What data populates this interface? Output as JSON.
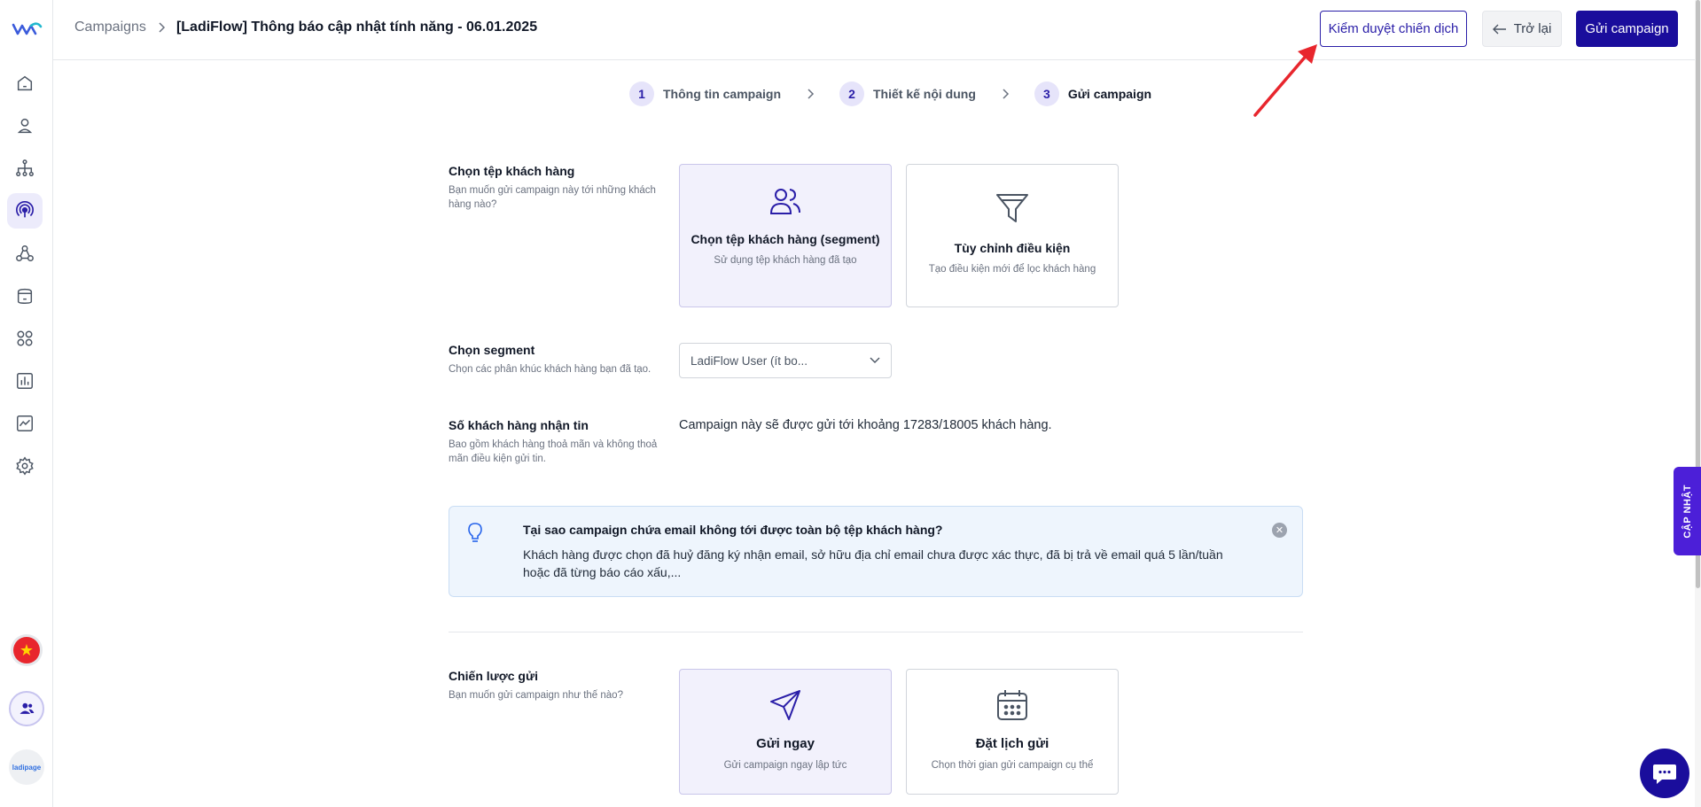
{
  "header": {
    "breadcrumb_root": "Campaigns",
    "breadcrumb_current": "[LadiFlow] Thông báo cập nhật tính năng - 06.01.2025",
    "review_button": "Kiểm duyệt chiến dịch",
    "back_button": "Trở lại",
    "send_button": "Gửi campaign"
  },
  "steps": [
    {
      "num": "1",
      "label": "Thông tin campaign"
    },
    {
      "num": "2",
      "label": "Thiết kế nội dung"
    },
    {
      "num": "3",
      "label": "Gửi campaign"
    }
  ],
  "audience": {
    "title": "Chọn tệp khách hàng",
    "desc": "Bạn muốn gửi campaign này tới những khách hàng nào?",
    "card_segment_title": "Chọn tệp khách hàng (segment)",
    "card_segment_desc": "Sử dụng tệp khách hàng đã tạo",
    "card_custom_title": "Tùy chỉnh điều kiện",
    "card_custom_desc": "Tạo điều kiện mới để lọc khách hàng"
  },
  "segment": {
    "title": "Chọn segment",
    "desc": "Chọn các phân khúc khách hàng bạn đã tạo.",
    "selected_value": "LadiFlow User (ít bo..."
  },
  "recipients": {
    "title": "Số khách hàng nhận tin",
    "desc": "Bao gồm khách hàng thoả mãn và không thoả mãn điều kiện gửi tin.",
    "text": "Campaign này sẽ được gửi tới khoảng 17283/18005 khách hàng."
  },
  "info": {
    "title": "Tại sao campaign chứa email không tới được toàn bộ tệp khách hàng?",
    "body": "Khách hàng được chọn đã huỷ đăng ký nhận email, sở hữu địa chỉ email chưa được xác thực, đã bị trả về email quá 5 lần/tuần hoặc đã từng báo cáo xấu,..."
  },
  "strategy": {
    "title": "Chiến lược gửi",
    "desc": "Bạn muốn gửi campaign như thế nào?",
    "card_now_title": "Gửi ngay",
    "card_now_desc": "Gửi campaign ngay lập tức",
    "card_schedule_title": "Đặt lịch gửi",
    "card_schedule_desc": "Chọn thời gian gửi campaign cụ thể"
  },
  "sidebar": {
    "items": [
      "home-icon",
      "user-icon",
      "hierarchy-icon",
      "broadcast-icon",
      "nodes-icon",
      "database-icon",
      "apps-icon",
      "bar-chart-icon",
      "activity-chart-icon",
      "settings-icon"
    ],
    "active_item": "broadcast-icon",
    "flag_glyph": "★",
    "ladipage_text": "ladipage"
  },
  "update_tab": "CẬP NHẬT",
  "colors": {
    "primary": "#1a0d9c",
    "accent_light": "#ecebfb",
    "info_bg": "#eef5fd",
    "annotation_arrow": "#e8262d"
  }
}
